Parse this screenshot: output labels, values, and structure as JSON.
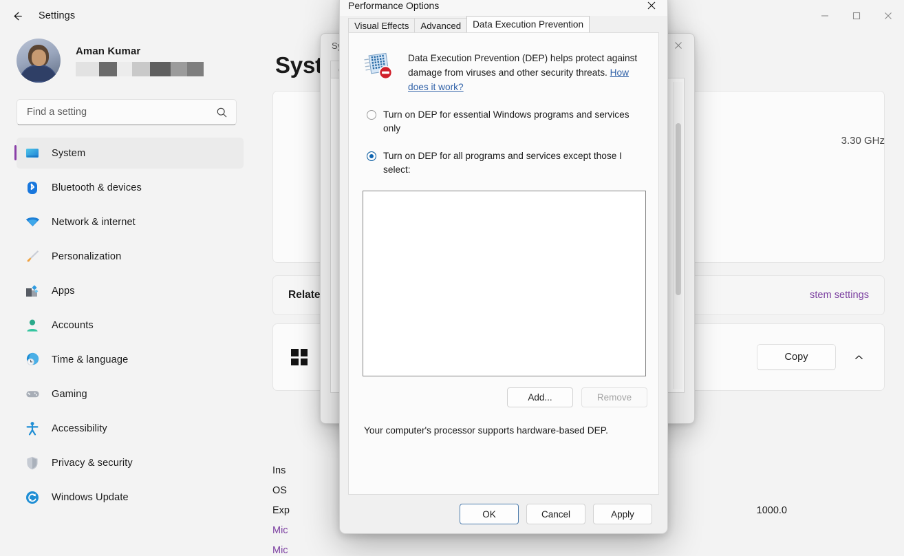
{
  "settings": {
    "titlebar": {
      "back_icon": "arrow-left-icon",
      "title": "Settings",
      "minimize": "—",
      "maximize": "☐",
      "close": "✕"
    },
    "account": {
      "name": "Aman Kumar",
      "email_redacted": true,
      "redaction_blocks": [
        "#e2e2e2",
        "#6b6b6b",
        "#ececec",
        "#c9c9c9",
        "#5f5f5f",
        "#9b9b9b",
        "#7e7e7e"
      ]
    },
    "search": {
      "placeholder": "Find a setting",
      "value": "",
      "icon": "search-icon"
    },
    "nav_items": [
      {
        "label": "System",
        "icon": "monitor-icon",
        "active": true
      },
      {
        "label": "Bluetooth & devices",
        "icon": "bluetooth-icon",
        "active": false
      },
      {
        "label": "Network & internet",
        "icon": "wifi-icon",
        "active": false
      },
      {
        "label": "Personalization",
        "icon": "paintbrush-icon",
        "active": false
      },
      {
        "label": "Apps",
        "icon": "apps-icon",
        "active": false
      },
      {
        "label": "Accounts",
        "icon": "person-icon",
        "active": false
      },
      {
        "label": "Time & language",
        "icon": "clock-globe-icon",
        "active": false
      },
      {
        "label": "Gaming",
        "icon": "gamepad-icon",
        "active": false
      },
      {
        "label": "Accessibility",
        "icon": "accessibility-icon",
        "active": false
      },
      {
        "label": "Privacy & security",
        "icon": "shield-icon",
        "active": false
      },
      {
        "label": "Windows Update",
        "icon": "refresh-icon",
        "active": false
      }
    ],
    "content": {
      "page_title": "System",
      "cpu_speed_fragment": "3.30 GHz",
      "related_label": "Relate",
      "related_link": "stem settings",
      "copy_button": "Copy",
      "expand_icon": "chevron-up-icon",
      "windows_logo": "windows-logo-icon",
      "spec_lines": [
        {
          "text": "Ins",
          "link": false
        },
        {
          "text": "OS",
          "link": false
        },
        {
          "text": "Exp",
          "link": false
        },
        {
          "text": "Mic",
          "link": true
        },
        {
          "text": "Mic",
          "link": true
        }
      ],
      "spec_right_fragment": "1000.0"
    }
  },
  "system_properties": {
    "title": "Sys",
    "close_icon": "close-icon",
    "tabs": [
      {
        "label": "Co"
      }
    ]
  },
  "performance_options": {
    "title": "Performance Options",
    "close_icon": "close-icon",
    "tabs": [
      {
        "label": "Visual Effects",
        "active": false
      },
      {
        "label": "Advanced",
        "active": false
      },
      {
        "label": "Data Execution Prevention",
        "active": true
      }
    ],
    "dep": {
      "icon": "dep-shield-icon",
      "description": "Data Execution Prevention (DEP) helps protect against damage from viruses and other security threats. ",
      "link_text": "How does it work?",
      "options": [
        {
          "label": "Turn on DEP for essential Windows programs and services only",
          "selected": false
        },
        {
          "label": "Turn on DEP for all programs and services except those I select:",
          "selected": true
        }
      ],
      "exception_list": [],
      "add_button": "Add...",
      "remove_button": "Remove",
      "remove_disabled": true,
      "status_text": "Your computer's processor supports hardware-based DEP."
    },
    "footer": {
      "ok": "OK",
      "cancel": "Cancel",
      "apply": "Apply"
    }
  },
  "colors": {
    "accent_purple": "#8a3fa8",
    "link_blue": "#3162a8",
    "radio_blue": "#0c63b0",
    "app_bg": "#f3f3f3",
    "dialog_bg": "#f0f0f0"
  }
}
